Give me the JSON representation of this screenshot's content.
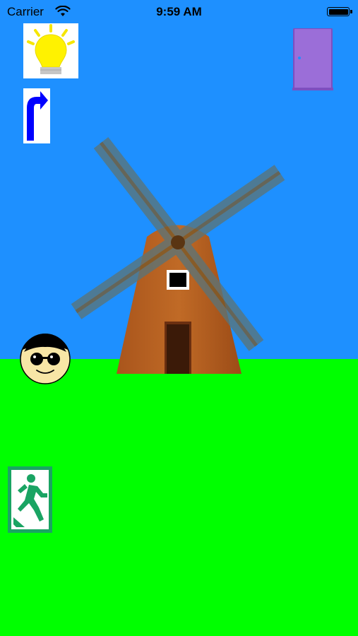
{
  "status_bar": {
    "carrier": "Carrier",
    "time": "9:59 AM",
    "wifi_icon": "wifi-icon",
    "battery_icon": "battery-icon"
  },
  "scene": {
    "sky_color": "#1e90ff",
    "grass_color": "#00ff00"
  },
  "controls": {
    "hint": {
      "icon": "lightbulb-icon"
    },
    "back": {
      "icon": "turn-arrow-icon"
    },
    "door": {
      "icon": "door-icon",
      "color": "#9a6ad6"
    },
    "exit": {
      "icon": "exit-running-man-icon",
      "color": "#1aa463"
    }
  },
  "sprites": {
    "player": "sunglasses-face",
    "windmill": "windmill"
  }
}
